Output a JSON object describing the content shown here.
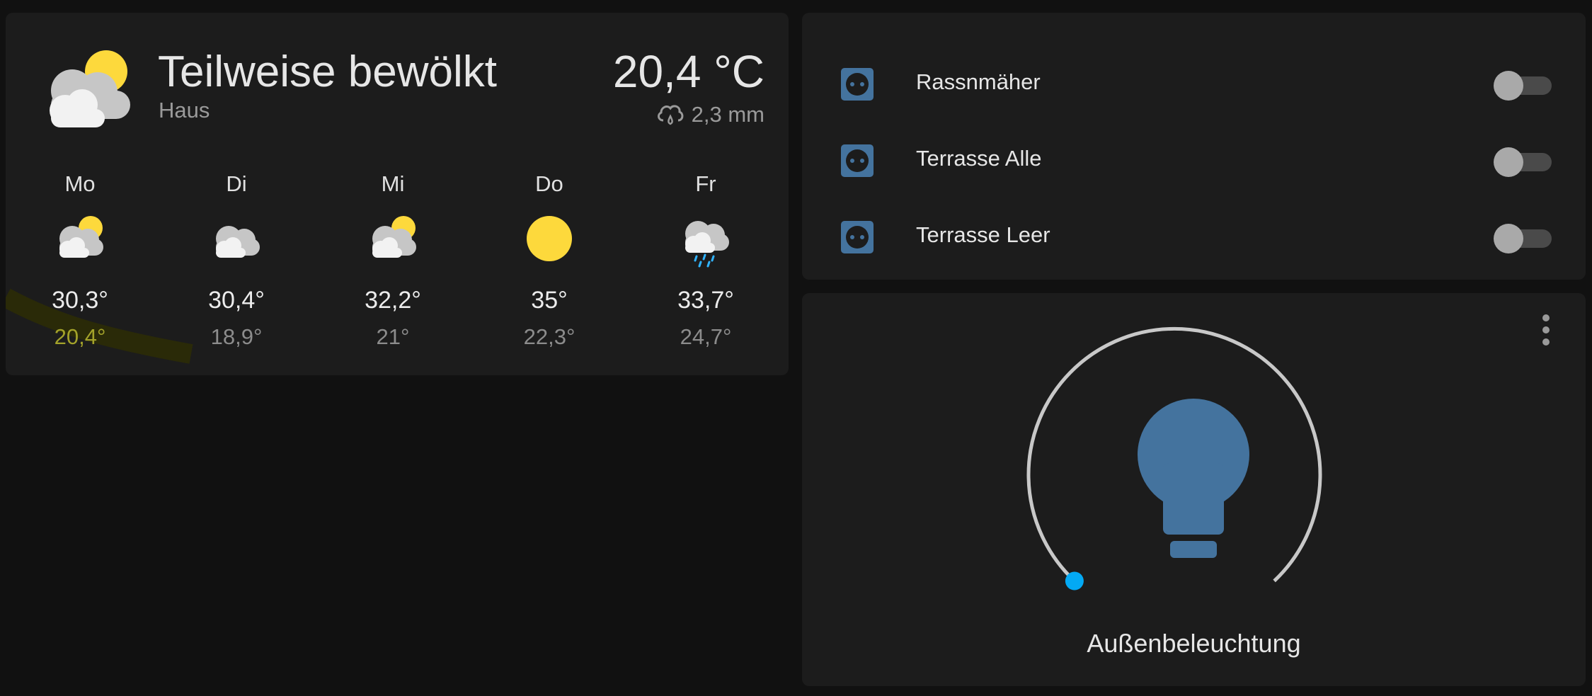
{
  "weather": {
    "condition": "Teilweise bewölkt",
    "location": "Haus",
    "temperature": "20,4 °C",
    "precipitation": "2,3 mm",
    "icon": "partly-cloudy-icon",
    "forecast": [
      {
        "day": "Mo",
        "icon": "partly-cloudy-icon",
        "high": "30,3°",
        "low": "20,4°"
      },
      {
        "day": "Di",
        "icon": "cloudy-icon",
        "high": "30,4°",
        "low": "18,9°"
      },
      {
        "day": "Mi",
        "icon": "partly-cloudy-icon",
        "high": "32,2°",
        "low": "21°"
      },
      {
        "day": "Do",
        "icon": "sunny-icon",
        "high": "35°",
        "low": "22,3°"
      },
      {
        "day": "Fr",
        "icon": "rainy-icon",
        "high": "33,7°",
        "low": "24,7°"
      }
    ]
  },
  "switches": [
    {
      "label": "Rassnmäher",
      "icon": "power-socket-icon",
      "state": "off"
    },
    {
      "label": "Terrasse Alle",
      "icon": "power-socket-icon",
      "state": "off"
    },
    {
      "label": "Terrasse Leer",
      "icon": "power-socket-icon",
      "state": "off"
    }
  ],
  "light": {
    "name": "Außenbeleuchtung",
    "icon": "lightbulb-icon",
    "brightness_fraction": 0,
    "state": "off"
  },
  "colors": {
    "background": "#111111",
    "card": "#1c1c1c",
    "icon_blue": "#44739e",
    "slider_handle": "#03a9f4",
    "sun": "#fdd93c"
  }
}
